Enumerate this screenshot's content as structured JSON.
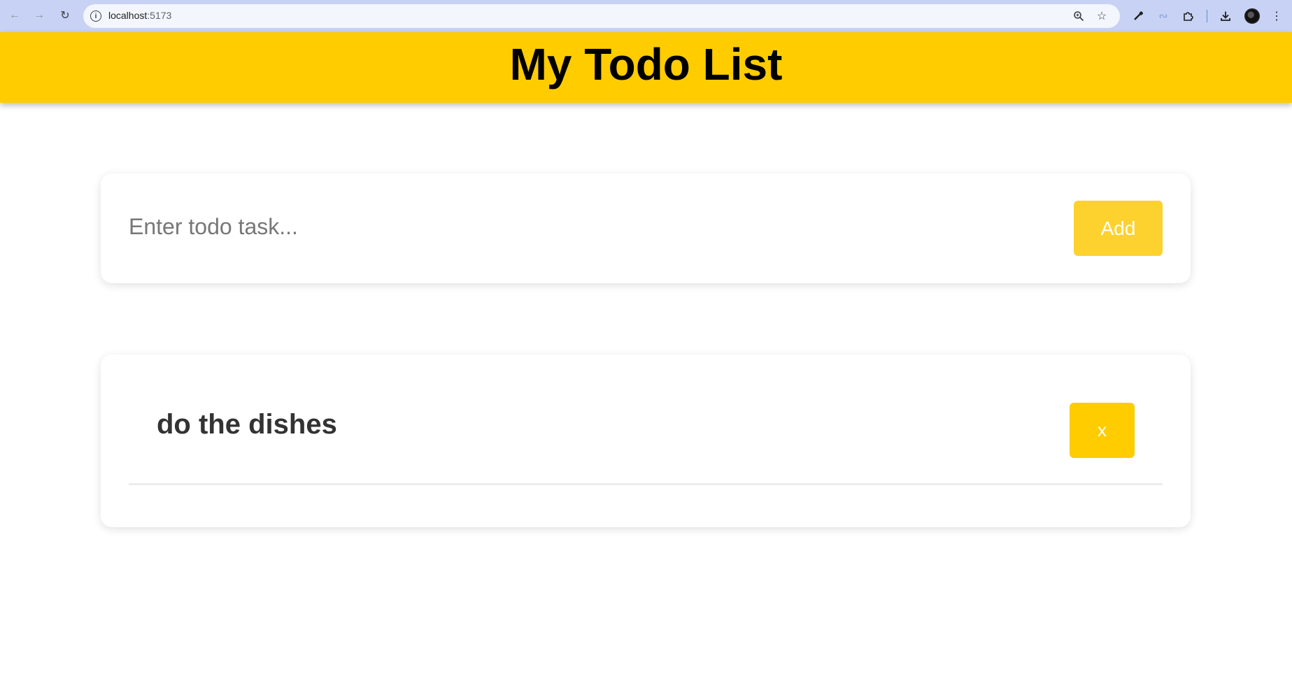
{
  "browser": {
    "url_host": "localhost",
    "url_port": ":5173"
  },
  "header": {
    "title": "My Todo List"
  },
  "form": {
    "input_value": "",
    "input_placeholder": "Enter todo task...",
    "add_label": "Add"
  },
  "todos": [
    {
      "text": "do the dishes",
      "delete_label": "x"
    }
  ],
  "colors": {
    "header_bg": "#ffcc00",
    "add_button_bg": "#fdd22e",
    "delete_button_bg": "#ffcc00",
    "chrome_bg": "#c7d2f4"
  }
}
